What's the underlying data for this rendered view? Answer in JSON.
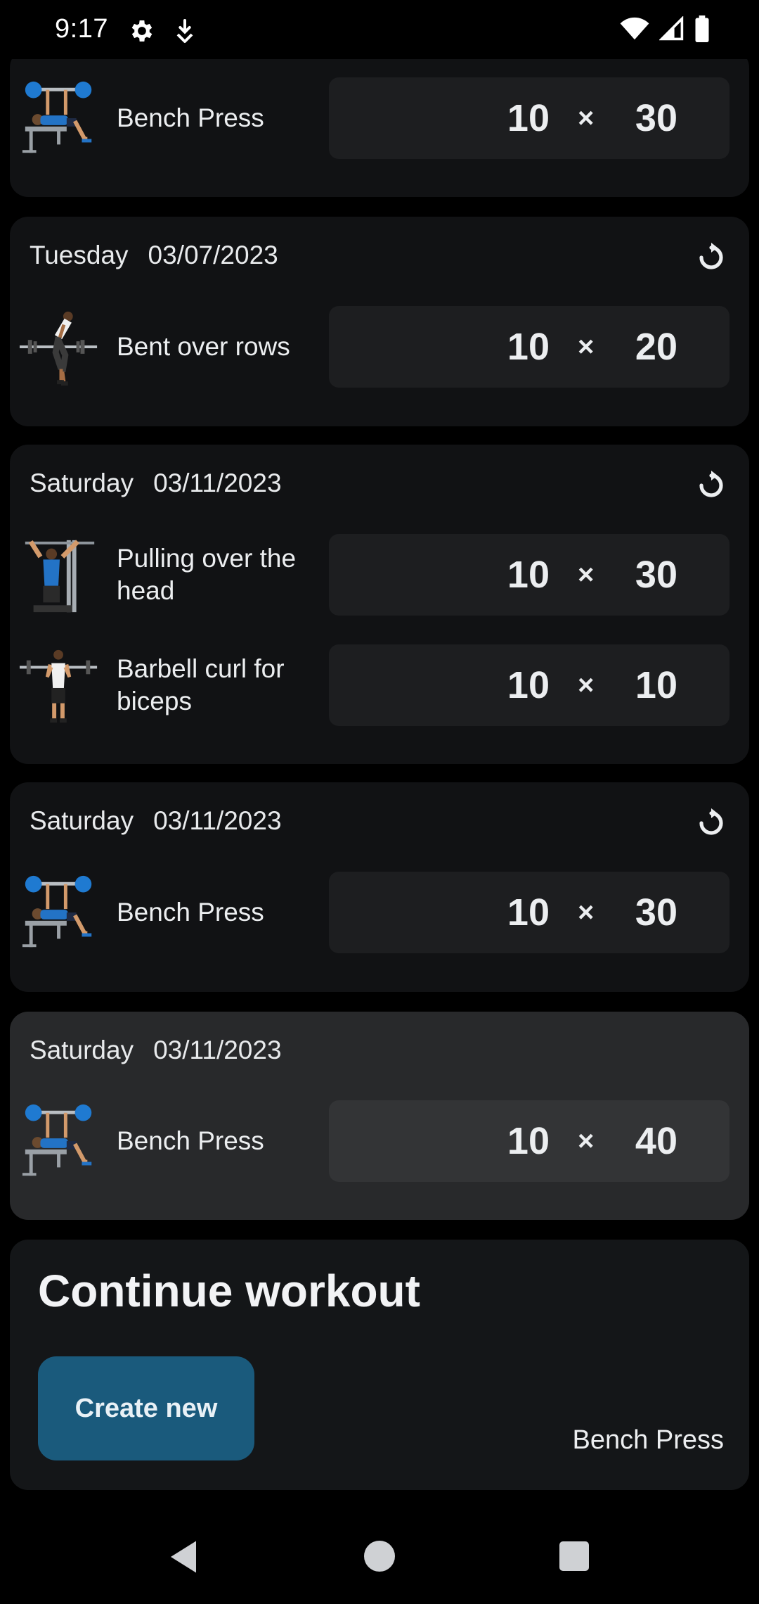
{
  "status_bar": {
    "time": "9:17",
    "icons": [
      "settings-icon",
      "download-icon",
      "wifi-icon",
      "signal-icon",
      "battery-icon"
    ]
  },
  "history": [
    {
      "day": "",
      "date": "",
      "exercises": [
        {
          "name": "Bench Press",
          "icon": "bench-press-figure",
          "reps": "10",
          "times": "×",
          "weight": "30"
        }
      ]
    },
    {
      "day": "Tuesday",
      "date": "03/07/2023",
      "exercises": [
        {
          "name": "Bent over rows",
          "icon": "bent-over-rows-figure",
          "reps": "10",
          "times": "×",
          "weight": "20"
        }
      ]
    },
    {
      "day": "Saturday",
      "date": "03/11/2023",
      "exercises": [
        {
          "name": "Pulling over the head",
          "icon": "pulldown-figure",
          "reps": "10",
          "times": "×",
          "weight": "30"
        },
        {
          "name": "Barbell curl for biceps",
          "icon": "barbell-curl-figure",
          "reps": "10",
          "times": "×",
          "weight": "10"
        }
      ]
    },
    {
      "day": "Saturday",
      "date": "03/11/2023",
      "exercises": [
        {
          "name": "Bench Press",
          "icon": "bench-press-figure",
          "reps": "10",
          "times": "×",
          "weight": "30"
        }
      ]
    },
    {
      "day": "Saturday",
      "date": "03/11/2023",
      "selected": true,
      "exercises": [
        {
          "name": "Bench Press",
          "icon": "bench-press-figure",
          "reps": "10",
          "times": "×",
          "weight": "40"
        }
      ]
    }
  ],
  "continue_workout": {
    "title": "Continue workout",
    "create_button": "Create new",
    "last_exercise": "Bench Press"
  },
  "colors": {
    "background": "#000000",
    "card": "#111214",
    "card_selected": "#28292b",
    "value_box": "#1d1e20",
    "accent_button": "#1a5a7c"
  }
}
